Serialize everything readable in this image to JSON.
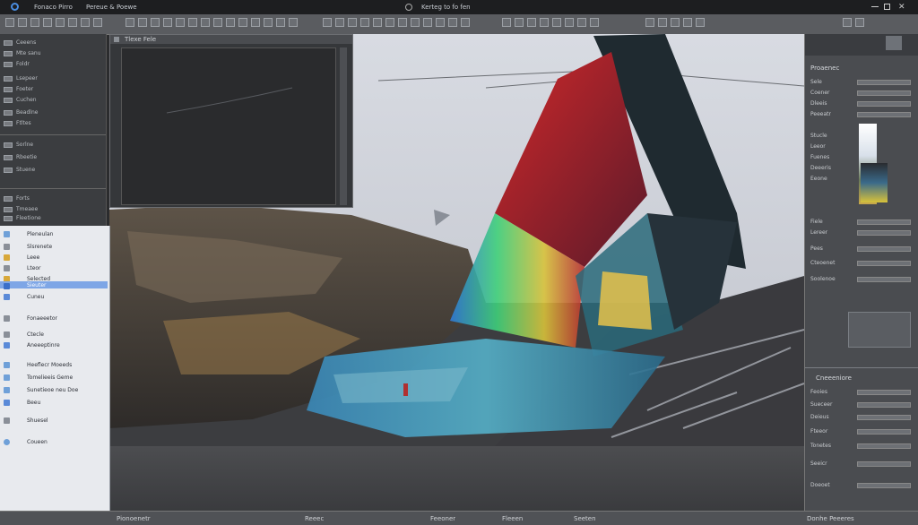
{
  "menubar": {
    "items": [
      "Fonaco Pirro",
      "Pereue & Poewe"
    ],
    "center_title": "Kerteg to fo fen",
    "colors": {
      "bg": "#1d1e20"
    }
  },
  "left_panel": {
    "rows": [
      "Ceeens",
      "Mte sanu",
      "Foldr",
      "Lsepeer",
      "Foeter",
      "Cuchen",
      "Beadlne",
      "Ftltes",
      "Sorlne",
      "Rbeetie",
      "Stuene",
      "Forts",
      "Tmeaee",
      "Fleetione"
    ]
  },
  "outliner": {
    "rows": [
      "Pleneulan",
      "Slsrenete",
      "Leee",
      "Lteor",
      "Selected",
      "Sieuter",
      "Cuneu",
      "Fonaeeetor",
      "Ctecle",
      "Aneeeptinre",
      "Heeflecr Moeeds",
      "Tomelieeis Geme",
      "Sunetieoe neu Doe",
      "Beeu",
      "Shuesel",
      "Coueen"
    ],
    "selected_index": 4
  },
  "graph_window": {
    "title": "Tlexe Fele"
  },
  "right_panel": {
    "header": "Proaenec",
    "rows": [
      "Sele",
      "Coener",
      "Dleeis",
      "Peeeatr",
      "Stucle",
      "Leeor",
      "Fuenes",
      "Deeeris",
      "Eeone",
      "Fiele",
      "Lereer",
      "Pees",
      "Cteoenet",
      "Soolenoe"
    ],
    "lower_header": "Cneeeniore",
    "lower_rows": [
      "Feoies",
      "Sueceer",
      "Deieus",
      "Fteeor",
      "Tonetes",
      "Seeicr",
      "Doeoet"
    ]
  },
  "statusbar": {
    "items": [
      "Pionoenetr",
      "Reeec",
      "Feeoner",
      "Fleeen",
      "Seeten",
      "Donhe Peeeres"
    ]
  }
}
